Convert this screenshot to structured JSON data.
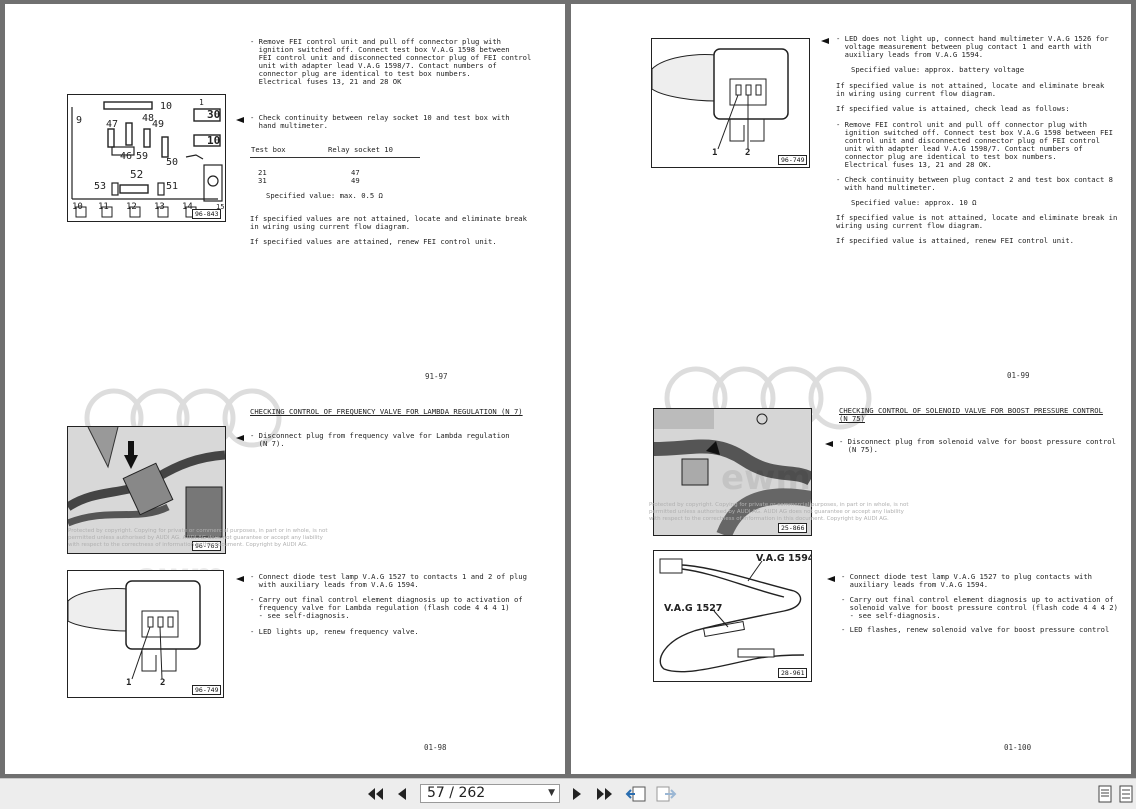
{
  "navigation": {
    "current_page": "57",
    "separator": "/",
    "total_pages": "262",
    "dropdown_caret": "▼",
    "first_icon": "skip-first-icon",
    "prev_icon": "previous-icon",
    "next_icon": "next-icon",
    "last_icon": "skip-last-icon"
  },
  "watermark": {
    "note": "Protected by copyright. Copying for private or commercial purposes, in part or in whole, is not\npermitted unless authorised by AUDI AG. AUDI AG does not guarantee or accept any liability\nwith respect to the correctness of information in this document. Copyright by AUDI AG."
  },
  "page_left": {
    "top_text": "- Remove FEI control unit and pull off connector plug with\n  ignition switched off. Connect test box V.A.G 1598 between\n  FEI control unit and disconnected connector plug of FEI control\n  unit with adapter lead V.A.G 1598/7. Contact numbers of\n  connector plug are identical to test box numbers.\n  Electrical fuses 13, 21 and 28 OK",
    "relay_check": "- Check continuity between relay socket 10 and test box with\n  hand multimeter.",
    "table_header_1": "Test box",
    "table_header_2": "Relay socket 10",
    "table_col1": "21\n31",
    "table_col2": "47\n49",
    "spec_value": "Specified value: max. 0.5 Ω",
    "not_attained": "If specified values are not attained, locate and eliminate break\nin wiring using current flow diagram.",
    "attained": "If specified values are attained, renew FEI control unit.",
    "relay_fig_label": "96-843",
    "relay_numbers": {
      "n1": "1",
      "n10": "10",
      "n30": "30",
      "n9": "9",
      "n47": "47",
      "n48": "48",
      "n49": "49",
      "n10b": "10",
      "n46": "46",
      "n59": "59",
      "n50": "50",
      "n52": "52",
      "n53": "53",
      "n51": "51",
      "b10": "10",
      "b11": "11",
      "b12": "12",
      "b13": "13",
      "b14": "14",
      "b15": "15"
    },
    "page_num_upper": "91-97",
    "heading_freq": "CHECKING CONTROL OF FREQUENCY VALVE FOR LAMBDA REGULATION (N 7)",
    "disconnect": "- Disconnect plug from frequency valve for Lambda regulation\n  (N 7).",
    "fig2_label": "96-763",
    "diode_text": "- Connect diode test lamp V.A.G 1527 to contacts 1 and 2 of plug\n  with auxiliary leads from V.A.G 1594.",
    "final_diag": "- Carry out final control element diagnosis up to activation of\n  frequency valve for Lambda regulation (flash code 4 4 4 1)\n  - see self-diagnosis.",
    "led_text": "- LED lights up, renew frequency valve.",
    "fig3_label": "96-749",
    "fig3_pin1": "1",
    "fig3_pin2": "2",
    "page_num_lower": "01-98"
  },
  "page_right": {
    "led_not": "- LED does not light up, connect hand multimeter V.A.G 1526 for\n  voltage measurement between plug contact 1 and earth with\n  auxiliary leads from V.A.G 1594.",
    "spec_batt": "Specified value: approx. battery voltage",
    "not_attained_1": "If specified value is not attained, locate and eliminate break\nin wiring using current flow diagram.",
    "attained_check": "If specified value is attained, check lead as follows:",
    "remove_fei": "- Remove FEI control unit and pull off connector plug with\n  ignition switched off. Connect test box V.A.G 1598 between FEI\n  control unit and disconnected connector plug of FEI control\n  unit with adapter lead V.A.G 1598/7. Contact numbers of\n  connector plug are identical to test box numbers.\n  Electrical fuses 13, 21 and 28 OK.",
    "check_cont": "- Check continuity between plug contact 2 and test box contact 8\n  with hand multimeter.",
    "spec_10": "Specified value: approx. 10 Ω",
    "not_attained_2": "If specified value is not attained, locate and eliminate break in\nwiring using current flow diagram.",
    "attained_renew": "If specified value is attained, renew FEI control unit.",
    "fig1_label": "96-749",
    "fig1_pin1": "1",
    "fig1_pin2": "2",
    "page_num_upper": "01-99",
    "heading_boost": "CHECKING CONTROL OF SOLENOID VALVE FOR BOOST PRESSURE CONTROL\n(N 75)",
    "disconnect": "- Disconnect plug from solenoid valve for boost pressure control\n  (N 75).",
    "fig2_label": "25-866",
    "fig3_label": "28-961",
    "fig3_vag1594": "V.A.G 1594",
    "fig3_vag1527": "V.A.G 1527",
    "diode_text": "- Connect diode test lamp V.A.G 1527 to plug contacts with\n  auxiliary leads from V.A.G 1594.",
    "final_diag": "- Carry out final control element diagnosis up to activation of\n  solenoid valve for boost pressure control (flash code 4 4 4 2)\n  - see self-diagnosis.",
    "led_flashes": "- LED flashes, renew solenoid valve for boost pressure control",
    "page_num_lower": "01-100"
  }
}
